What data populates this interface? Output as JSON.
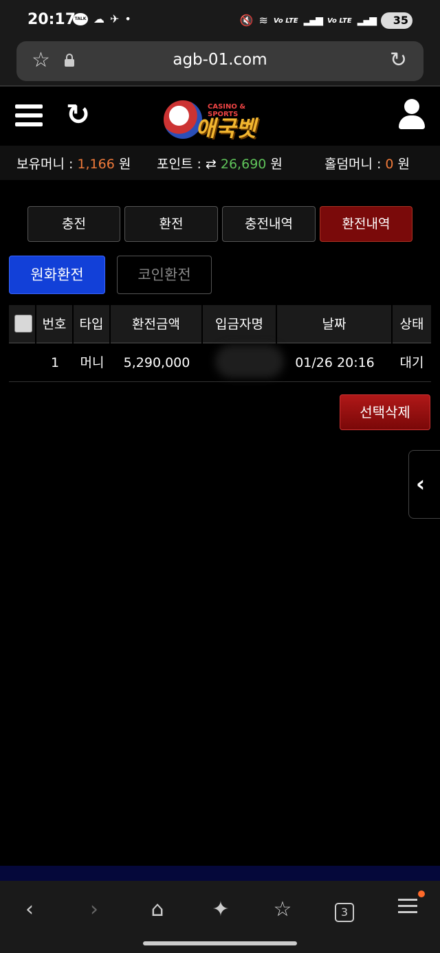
{
  "status_bar": {
    "time": "20:17",
    "talk_badge": "TALK",
    "lte1": "Vo LTE",
    "lte2": "Vo LTE",
    "battery": "35"
  },
  "browser": {
    "url": "agb-01.com",
    "tab_count": "3"
  },
  "logo": {
    "sub_text": "CASINO & SPORTS",
    "main_text": "애국벳"
  },
  "money_bar": {
    "holding_label": "보유머니 : ",
    "holding_value": "1,166",
    "holding_unit": " 원",
    "point_label": "포인트 : ",
    "point_arrow": "⇄",
    "point_value": " 26,690",
    "point_unit": " 원",
    "holdem_label": "홀덤머니 : ",
    "holdem_value": "0",
    "holdem_unit": " 원"
  },
  "tabs": [
    "충전",
    "환전",
    "충전내역",
    "환전내역"
  ],
  "sub_tabs": [
    "원화환전",
    "코인환전"
  ],
  "table": {
    "headers": [
      "번호",
      "타입",
      "환전금액",
      "입금자명",
      "날짜",
      "상태"
    ],
    "rows": [
      {
        "no": "1",
        "type": "머니",
        "amount": "5,290,000",
        "name": "",
        "date": "01/26 20:16",
        "status": "대기"
      }
    ]
  },
  "delete_button": "선택삭제",
  "colors": {
    "active_tab": "#7a0a0a",
    "active_sub_tab": "#1240d8",
    "holding_value": "#f07a3a",
    "point_value": "#5fc45a",
    "delete_button": "#b01818"
  }
}
